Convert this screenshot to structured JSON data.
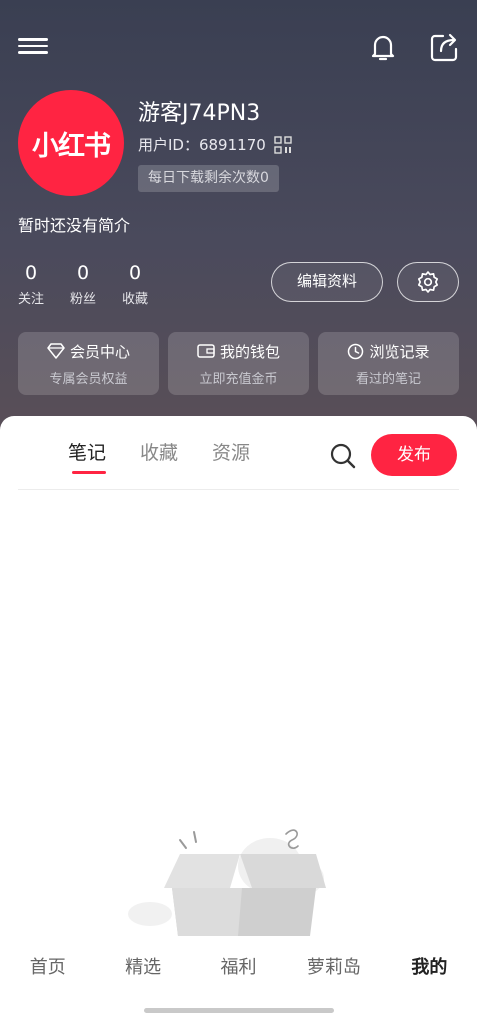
{
  "profile": {
    "username": "游客J74PN3",
    "user_id": "用户ID：6891170",
    "download_badge": "每日下载剩余次数0",
    "bio": "暂时还没有简介",
    "avatar_text": "小红书"
  },
  "stats": [
    {
      "num": "0",
      "label": "关注"
    },
    {
      "num": "0",
      "label": "粉丝"
    },
    {
      "num": "0",
      "label": "收藏"
    }
  ],
  "actions": {
    "edit_label": "编辑资料"
  },
  "cards": [
    {
      "title": "会员中心",
      "sub": "专属会员权益",
      "icon": "diamond-icon"
    },
    {
      "title": "我的钱包",
      "sub": "立即充值金币",
      "icon": "wallet-icon"
    },
    {
      "title": "浏览记录",
      "sub": "看过的笔记",
      "icon": "clock-icon"
    }
  ],
  "tabs": [
    {
      "label": "笔记",
      "active": true
    },
    {
      "label": "收藏",
      "active": false
    },
    {
      "label": "资源",
      "active": false
    }
  ],
  "publish_label": "发布",
  "bottom_nav": [
    {
      "label": "首页",
      "active": false
    },
    {
      "label": "精选",
      "active": false
    },
    {
      "label": "福利",
      "active": false
    },
    {
      "label": "萝莉岛",
      "active": false
    },
    {
      "label": "我的",
      "active": true
    }
  ],
  "colors": {
    "accent": "#ff2442",
    "header_bg": "#3a3f52"
  }
}
